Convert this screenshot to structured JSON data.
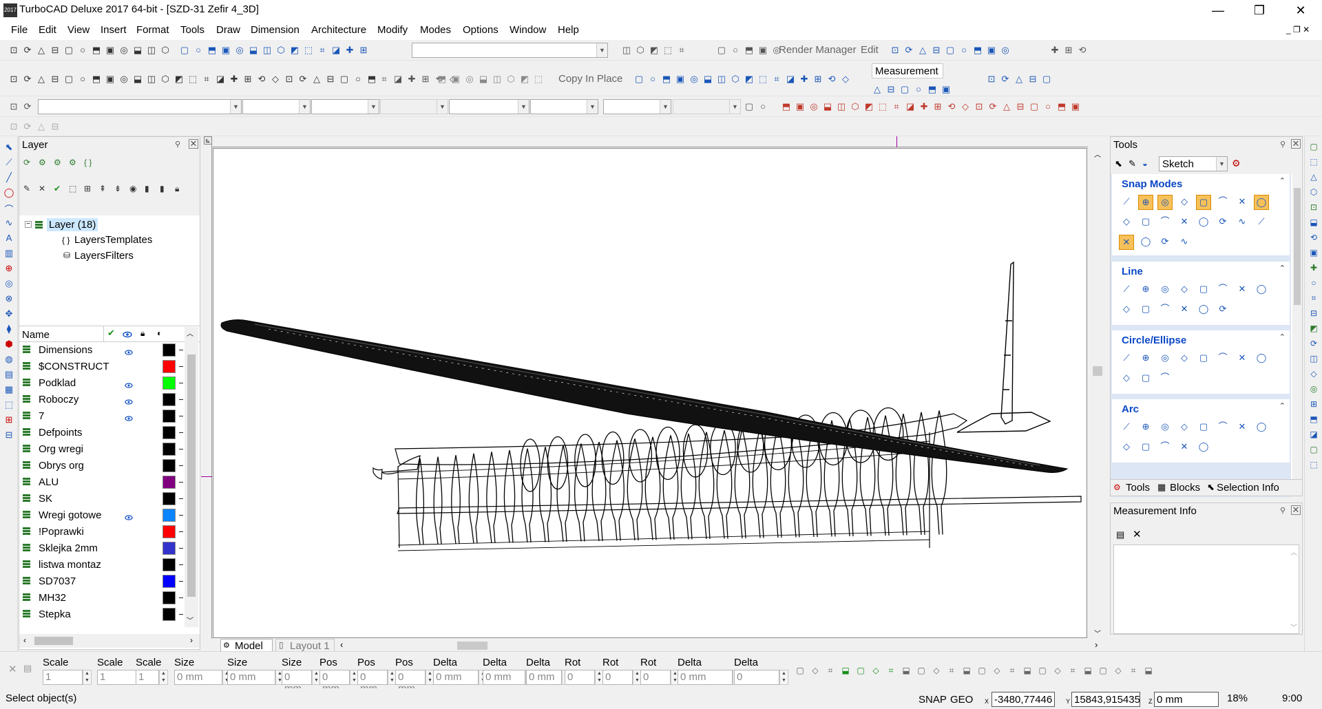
{
  "window": {
    "title": "TurboCAD Deluxe 2017 64-bit - [SZD-31 Zefir 4_3D]",
    "logo_text": "2017",
    "minimize": "—",
    "maximize": "❐",
    "close": "✕"
  },
  "menu": [
    "File",
    "Edit",
    "View",
    "Insert",
    "Format",
    "Tools",
    "Draw",
    "Dimension",
    "Architecture",
    "Modify",
    "Modes",
    "Options",
    "Window",
    "Help"
  ],
  "toolbar": {
    "render_manager": "Render Manager",
    "edit": "Edit",
    "copy_in_place": "Copy In Place",
    "measurement": "Measurement"
  },
  "layer_panel": {
    "title": "Layer",
    "tree": {
      "root": "Layer (18)",
      "children": [
        "LayersTemplates",
        "LayersFilters"
      ]
    },
    "column_name": "Name",
    "rows": [
      {
        "name": "Dimensions",
        "visible": true,
        "color": "#000000"
      },
      {
        "name": "$CONSTRUCT",
        "visible": false,
        "color": "#ff0000"
      },
      {
        "name": "Podklad",
        "visible": true,
        "color": "#00ff00"
      },
      {
        "name": "Roboczy",
        "visible": true,
        "color": "#000000"
      },
      {
        "name": "7",
        "visible": true,
        "color": "#000000"
      },
      {
        "name": "Defpoints",
        "visible": false,
        "color": "#000000"
      },
      {
        "name": "Org wregi",
        "visible": false,
        "color": "#000000"
      },
      {
        "name": "Obrys org",
        "visible": false,
        "color": "#000000"
      },
      {
        "name": "ALU",
        "visible": false,
        "color": "#800080"
      },
      {
        "name": "SK",
        "visible": false,
        "color": "#000000"
      },
      {
        "name": "Wregi gotowe",
        "visible": true,
        "color": "#0a84ff"
      },
      {
        "name": "!Poprawki",
        "visible": false,
        "color": "#ff0000"
      },
      {
        "name": "Sklejka 2mm",
        "visible": false,
        "color": "#3333cc"
      },
      {
        "name": "listwa montaz",
        "visible": false,
        "color": "#000000"
      },
      {
        "name": "SD7037",
        "visible": false,
        "color": "#0000ff"
      },
      {
        "name": "MH32",
        "visible": false,
        "color": "#000000"
      },
      {
        "name": "Stepka",
        "visible": false,
        "color": "#000000"
      }
    ],
    "row_dash": "–"
  },
  "tools_panel": {
    "title": "Tools",
    "mode": "Sketch",
    "sections": [
      "Snap Modes",
      "Line",
      "Circle/Ellipse",
      "Arc"
    ],
    "tabs": [
      "Tools",
      "Blocks",
      "Selection Info"
    ]
  },
  "measurement_info": {
    "title": "Measurement Info"
  },
  "viewport": {
    "tabs": [
      "Model",
      "Layout 1"
    ]
  },
  "inspector": {
    "fields": [
      {
        "label": "Scale X",
        "value": "1"
      },
      {
        "label": "Scale Y",
        "value": "1"
      },
      {
        "label": "Scale Z",
        "value": "1"
      },
      {
        "label": "Size X",
        "value": "0 mm"
      },
      {
        "label": "Size Y",
        "value": "0 mm"
      },
      {
        "label": "Size Z",
        "value": "0 mm"
      },
      {
        "label": "Pos X",
        "value": "0 mm"
      },
      {
        "label": "Pos Y",
        "value": "0 mm"
      },
      {
        "label": "Pos Z",
        "value": "0 mm"
      },
      {
        "label": "Delta X",
        "value": "0 mm"
      },
      {
        "label": "Delta Y",
        "value": "0 mm"
      },
      {
        "label": "Delta Z",
        "value": "0 mm"
      },
      {
        "label": "Rot X",
        "value": "0"
      },
      {
        "label": "Rot Y",
        "value": "0"
      },
      {
        "label": "Rot Z",
        "value": "0"
      },
      {
        "label": "Delta Distai",
        "value": "0 mm"
      },
      {
        "label": "Delta Angle",
        "value": "0"
      }
    ]
  },
  "status": {
    "prompt": "Select object(s)",
    "snap": "SNAP",
    "geo": "GEO",
    "x_label": "X",
    "x_value": "-3480,77446",
    "y_label": "Y",
    "y_value": "15843,915435",
    "z_label": "Z",
    "z_value": "0 mm",
    "zoom": "18%",
    "time": "9:00"
  },
  "colors": {
    "accent_snap": "#f7c15a",
    "section_header": "#0a47c6",
    "selected_tree": "#cce8ff"
  }
}
